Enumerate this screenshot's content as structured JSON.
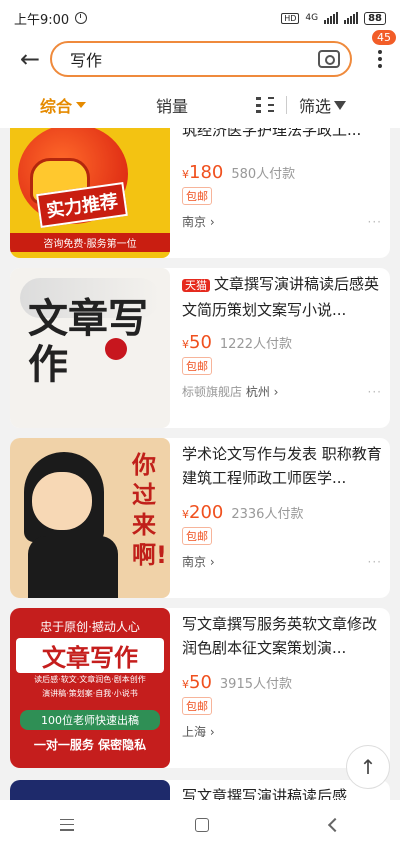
{
  "status": {
    "time": "上午9:00",
    "hd": "HD",
    "network": "4G",
    "battery": "88"
  },
  "search": {
    "value": "写作",
    "cart_count": "45"
  },
  "sort": {
    "comprehensive": "综合",
    "sales": "销量",
    "filter": "筛选"
  },
  "products": [
    {
      "title": "筑经济医学护理法学政工...",
      "tmall": "",
      "price": "180",
      "paid": "580人付款",
      "tag": "包邮",
      "shop": "",
      "location": "南京",
      "thumb_lines": [
        "实力推荐",
        "咨询免费·服务第一位"
      ]
    },
    {
      "title": "文章撰写演讲稿读后感英文简历策划文案写小说...",
      "tmall": "天猫",
      "price": "50",
      "paid": "1222人付款",
      "tag": "包邮",
      "shop": "标顿旗舰店",
      "location": "杭州",
      "thumb_lines": [
        "文章写作"
      ]
    },
    {
      "title": "学术论文写作与发表 职称教育建筑工程师政工师医学...",
      "tmall": "",
      "price": "200",
      "paid": "2336人付款",
      "tag": "包邮",
      "shop": "",
      "location": "南京",
      "thumb_lines": [
        "你过来啊!"
      ]
    },
    {
      "title": "写文章撰写服务英软文章修改润色剧本征文案策划演...",
      "tmall": "",
      "price": "50",
      "paid": "3915人付款",
      "tag": "包邮",
      "shop": "",
      "location": "上海",
      "thumb_lines": [
        "忠于原创·撼动人心",
        "文章写作",
        "读后感·软文·文章润色·剧本创作",
        "演讲稿·策划案·自我·小说书",
        "100位老师快速出稿",
        "一对一服务 保密隐私"
      ]
    }
  ],
  "partial_title": "写文章撰写演讲稿读后感"
}
